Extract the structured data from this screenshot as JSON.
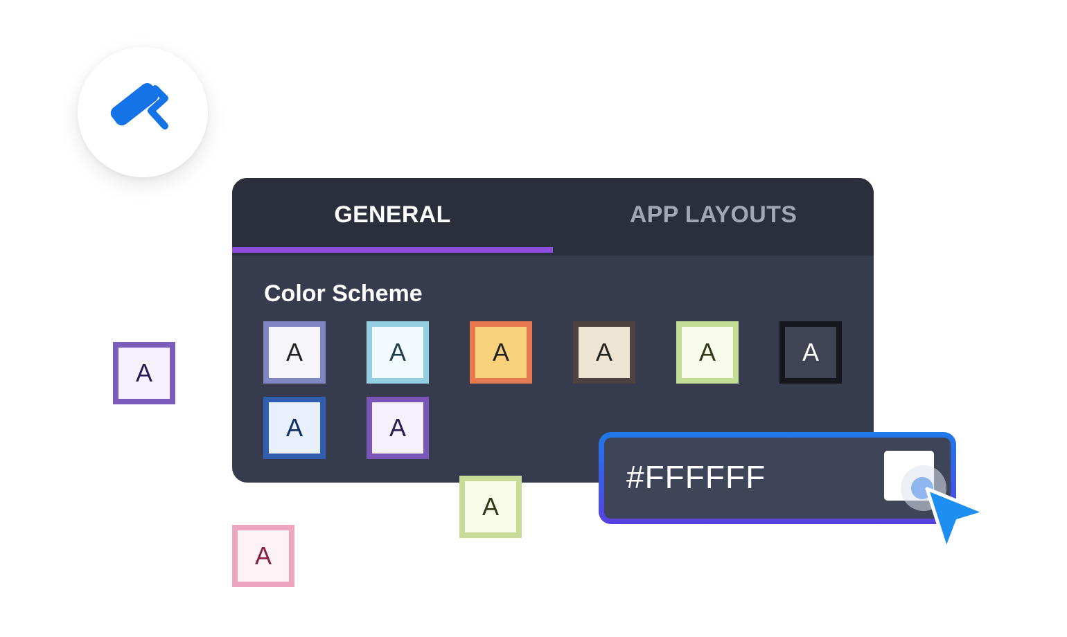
{
  "icon": {
    "name": "paint-roller-icon",
    "color": "#1473e6"
  },
  "tabs": [
    {
      "label": "GENERAL",
      "active": true
    },
    {
      "label": "APP LAYOUTS",
      "active": false
    }
  ],
  "accent_color": "#8f4ee0",
  "section": {
    "title": "Color Scheme"
  },
  "swatches": [
    {
      "letter": "A",
      "border": "#7f86c1",
      "fill": "#f6f6fa",
      "text": "#222222"
    },
    {
      "letter": "A",
      "border": "#93cfe0",
      "fill": "#f1fafc",
      "text": "#1f3d4c"
    },
    {
      "letter": "A",
      "border": "#e6794f",
      "fill": "#f9d37c",
      "text": "#222222"
    },
    {
      "letter": "A",
      "border": "#4c4240",
      "fill": "#ede4d4",
      "text": "#222222"
    },
    {
      "letter": "A",
      "border": "#c4dd95",
      "fill": "#f8fbe9",
      "text": "#2e3a17"
    },
    {
      "letter": "A",
      "border": "#16171c",
      "fill": "#3f4354",
      "text": "#ffffff"
    },
    {
      "letter": "A",
      "border": "#2f5db0",
      "fill": "#e8f0fb",
      "text": "#0b2e66"
    },
    {
      "letter": "A",
      "border": "#7a55b8",
      "fill": "#f4f1fb",
      "text": "#2a1a55"
    }
  ],
  "floating_swatches": [
    {
      "letter": "A",
      "border": "#7c5cbd",
      "fill": "#f5f2fb",
      "text": "#2a1a55"
    },
    {
      "letter": "A",
      "border": "#c8dc97",
      "fill": "#f9fbe9",
      "text": "#2e3a17"
    },
    {
      "letter": "A",
      "border": "#eea6c0",
      "fill": "#fcf3f6",
      "text": "#8a1f3f"
    }
  ],
  "hex_input": {
    "value": "#FFFFFF",
    "preview_color": "#FFFFFF"
  },
  "pointer": {
    "name": "cursor-arrow-icon",
    "color": "#1e8ff0"
  }
}
